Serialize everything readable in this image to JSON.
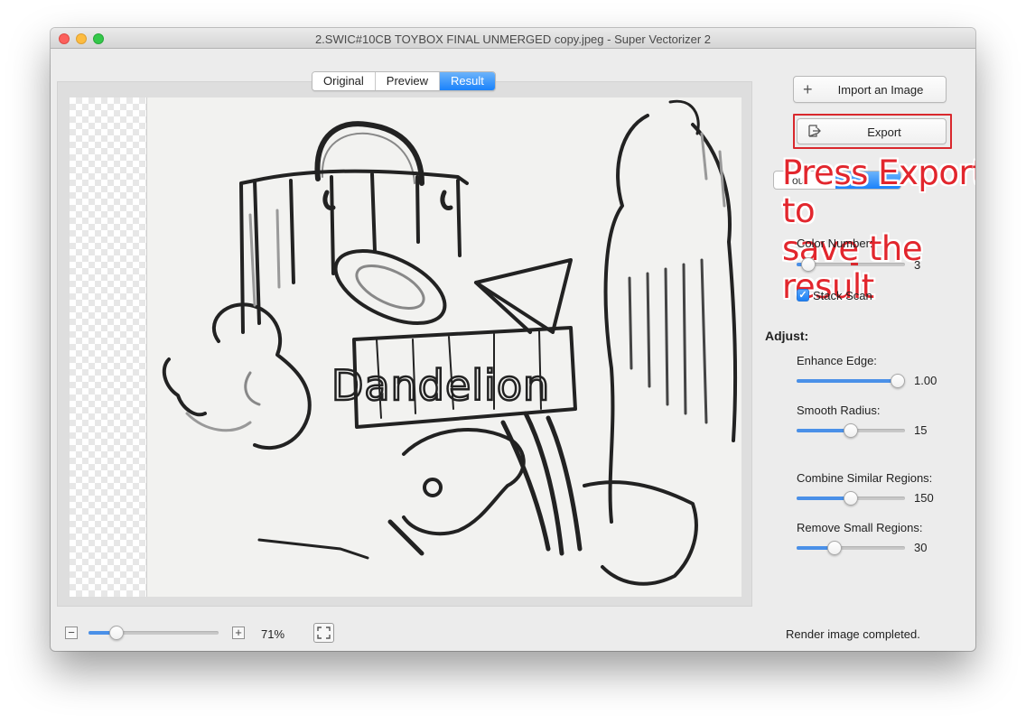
{
  "window": {
    "title": "2.SWIC#10CB TOYBOX FINAL UNMERGED copy.jpeg - Super Vectorizer 2"
  },
  "view_tabs": [
    {
      "label": "Original",
      "active": false
    },
    {
      "label": "Preview",
      "active": false
    },
    {
      "label": "Result",
      "active": true
    }
  ],
  "canvas": {
    "lettering": "Dandelion"
  },
  "actions": {
    "import_label": "Import an Image",
    "import_icon": "plus-icon",
    "export_label": "Export",
    "export_icon": "export-icon"
  },
  "hidden_segment": {
    "left_label": "ous"
  },
  "annotation": {
    "text_line1": "Press Export to",
    "text_line2": "save the result",
    "color": "#e2262d"
  },
  "settings": {
    "color_number": {
      "label": "Color Number:",
      "value": "3",
      "level": 0.05
    },
    "stack_scan": {
      "label": "Stack Scan",
      "checked": true
    }
  },
  "adjust": {
    "heading": "Adjust:",
    "enhance_edge": {
      "label": "Enhance Edge:",
      "value": "1.00",
      "level": 1.0
    },
    "smooth_radius": {
      "label": "Smooth Radius:",
      "value": "15",
      "level": 0.5
    },
    "combine_similar": {
      "label": "Combine Similar Regions:",
      "value": "150",
      "level": 0.5
    },
    "remove_small": {
      "label": "Remove Small Regions:",
      "value": "30",
      "level": 0.33
    }
  },
  "zoom": {
    "level": "71%",
    "minus": "−",
    "plus": "+",
    "slider_level": 0.18
  },
  "status": {
    "text": "Render image completed."
  },
  "colors": {
    "accent": "#1a82fb",
    "highlight": "#d9282d",
    "slider_fill": "#4a90e8"
  }
}
